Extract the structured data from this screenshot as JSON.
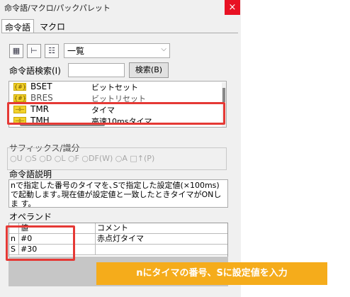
{
  "window": {
    "title": "命令語/マクロ/パックパレット",
    "close_glyph": "×"
  },
  "tabs": [
    {
      "label": "命令語",
      "active": true
    },
    {
      "label": "マクロ",
      "active": false
    }
  ],
  "toolbar": {
    "view_combo_value": "一覧",
    "icons": [
      "grid-view-icon",
      "tree-view-icon",
      "list-view-icon"
    ]
  },
  "search": {
    "label": "命令語検索(I)",
    "value": "",
    "button_label": "検索(B)"
  },
  "instruction_list": [
    {
      "name": "BSET",
      "desc": "ビットセット",
      "icon": "instruction-icon",
      "selected": false
    },
    {
      "name": "BRES",
      "desc": "ビットリセット",
      "icon": "instruction-icon",
      "selected": false
    },
    {
      "name": "TMR",
      "desc": "タイマ",
      "icon": "instruction-icon",
      "selected": true
    },
    {
      "name": "TMH",
      "desc": "高速10msタイマ",
      "icon": "instruction-icon",
      "selected": false
    }
  ],
  "suffix": {
    "label": "サフィックス/識分",
    "options": "○U ○S ○D ○L ○F ○DF(W) ○A □↑(P)"
  },
  "description": {
    "label": "命令語説明",
    "text": "nで指定した番号のタイマを､Sで指定した設定値(×100ms)で起動します｡現在値が設定値と一致したときタイマがONしま す。"
  },
  "operand": {
    "label": "オペランド",
    "headers": [
      "",
      "値",
      "コメント"
    ],
    "rows": [
      {
        "name": "n",
        "value": "#0",
        "comment": "赤点灯タイマ"
      },
      {
        "name": "S",
        "value": "#30",
        "comment": ""
      }
    ]
  },
  "callout": {
    "text": "nにタイマの番号、Sに設定値を入力"
  },
  "colors": {
    "highlight_red": "#e53935",
    "callout_orange": "#f5ac1b",
    "close_red": "#e81123",
    "instruction_icon_yellow": "#f3d22b"
  }
}
